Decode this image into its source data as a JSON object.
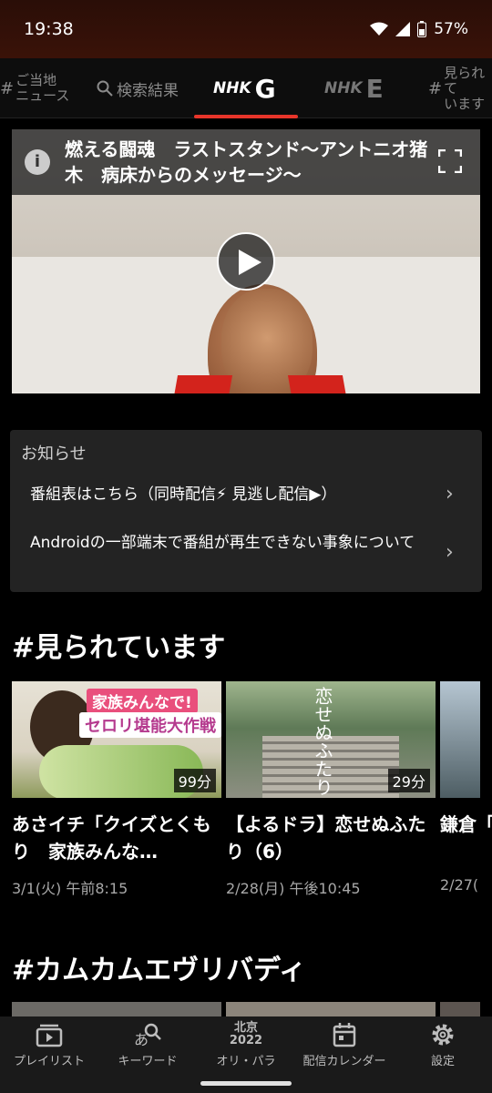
{
  "status": {
    "time": "19:38",
    "battery": "57%"
  },
  "tabs": {
    "local_hash": "#",
    "local_line1": "ご当地",
    "local_line2": "ニュース",
    "search": "検索結果",
    "g_brand": "NHK",
    "g_letter": "G",
    "e_brand": "NHK",
    "e_letter": "E",
    "popular_hash": "#",
    "popular_line1": "見られて",
    "popular_line2": "います",
    "accent_color": "#e8352a"
  },
  "player": {
    "title": "燃える闘魂　ラストスタンド～アントニオ猪木　病床からのメッセージ～",
    "info_glyph": "i"
  },
  "notices": {
    "heading": "お知らせ",
    "items": [
      "番組表はこちら（同時配信⚡ 見逃し配信▶）",
      "Androidの一部端末で番組が再生できない事象について"
    ],
    "chevron": "›"
  },
  "sections": {
    "popular_title": "#見られています",
    "second_title": "#カムカムエヴリバディ"
  },
  "cards": [
    {
      "title": "あさイチ「クイズとくもり　家族みんな…",
      "date": "3/1(火) 午前8:15",
      "duration": "99分",
      "banner1": "家族みんなで!",
      "banner2": "セロリ堪能大作戦"
    },
    {
      "title": "【よるドラ】恋せぬふたり（6）",
      "date": "2/28(月) 午後10:45",
      "duration": "29分",
      "vertical_text": "恋せぬふたり"
    },
    {
      "title": "鎌倉「い",
      "date": "2/27("
    }
  ],
  "bottom_nav": [
    {
      "label": "プレイリスト",
      "icon": "playlist-icon"
    },
    {
      "label": "キーワード",
      "icon": "keyword-search-icon"
    },
    {
      "label": "オリ・パラ",
      "icon": "beijing-2022-icon",
      "icon_line1": "北京",
      "icon_line2": "2022"
    },
    {
      "label": "配信カレンダー",
      "icon": "calendar-icon"
    },
    {
      "label": "設定",
      "icon": "gear-icon"
    }
  ]
}
